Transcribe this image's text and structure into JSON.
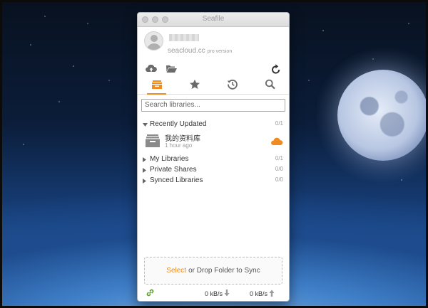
{
  "window": {
    "title": "Seafile"
  },
  "account": {
    "server": "seacloud.cc",
    "server_suffix": "pro version"
  },
  "search": {
    "placeholder": "Search libraries..."
  },
  "groups": {
    "recent": {
      "label": "Recently Updated",
      "count": "0/1"
    },
    "my": {
      "label": "My Libraries",
      "count": "0/1"
    },
    "private": {
      "label": "Private Shares",
      "count": "0/0"
    },
    "synced": {
      "label": "Synced Libraries",
      "count": "0/0"
    }
  },
  "repo": {
    "name": "我的资料库",
    "time": "1 hour ago"
  },
  "dropzone": {
    "select_label": "Select",
    "rest_label": "or Drop Folder to Sync"
  },
  "footer": {
    "download_rate": "0 kB/s",
    "upload_rate": "0 kB/s"
  },
  "colors": {
    "accent": "#ef8b1f",
    "icon": "#6a6a6a"
  },
  "icons": {
    "tabs": [
      "libraries-icon",
      "star-icon",
      "history-icon",
      "search-icon"
    ],
    "actions": [
      "cloud-upload-icon",
      "folder-open-icon",
      "refresh-icon"
    ]
  }
}
